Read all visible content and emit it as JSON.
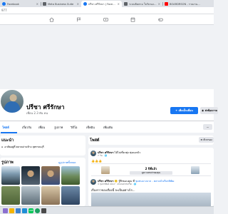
{
  "browser": {
    "tabs": [
      {
        "label": "Facebook",
        "icon": "facebook-icon",
        "active": false
      },
      {
        "label": "Meta Business Suite",
        "icon": "document-icon",
        "active": false
      },
      {
        "label": "ปรีชา ศรีรักษา | Facebook",
        "icon": "facebook-icon",
        "active": true
      },
      {
        "label": "ระบบติดตาม ใบรับรองแพทย์ออนไลน์",
        "icon": "document-icon",
        "active": false
      },
      {
        "label": "BOARDRSON - รายงานผลโพล",
        "icon": "youtube-icon",
        "active": false
      }
    ],
    "address_fragment": "977"
  },
  "profile": {
    "name": "ปรีชา ศรีรักษา",
    "friends": "เพื่อน 2.3 พัน คน",
    "add_friend_label": "เพิ่มเป็นเพื่อน",
    "message_label": "ส่งข้อความ"
  },
  "profile_tabs": [
    {
      "label": "โพสต์",
      "active": true
    },
    {
      "label": "เกี่ยวกับ",
      "active": false
    },
    {
      "label": "เพื่อน",
      "active": false
    },
    {
      "label": "รูปภาพ",
      "active": false
    },
    {
      "label": "วิดีโอ",
      "active": false
    },
    {
      "label": "เช็คอิน",
      "active": false
    },
    {
      "label": "เพิ่มเติม",
      "active": false
    }
  ],
  "more_label": "···",
  "intro": {
    "title": "แนะนำ",
    "line": "อาศัยอยู่ที่ ตลาดด่านช้าง สุพรรณบุรี"
  },
  "photos": {
    "title": "รูปภาพ",
    "see_all": "ดูรูปภาพทั้งหมด"
  },
  "posts": {
    "title": "โพสต์",
    "filter_label": "ตัวกรอง"
  },
  "post1": {
    "author": "ปรีชา ศรีรักษา",
    "action": " ได้ไปเที่ยวทุ่ง ทุ่งดอกบัว",
    "time": "7 วัน · 🌐",
    "reactions": "👍👍👍"
  },
  "event": {
    "title": "2 ปีที่แล้ว",
    "subtitle": "ดูความทรงจำของคุณ"
  },
  "post2": {
    "author": "ปรีชา ศรีรักษา",
    "mid": " 🙂 รู้สึกขอบคุณ ที่ ",
    "link": "ชุมชนบางบาล - ตลาดบัวเกียรติพัฒ",
    "time": "3 กุมภาพันธ์ 2017 · อำเภอปากเกร็ด · 🌐",
    "text": "เรื่องราวของเรื่องนี้ จะเป็นอย่างไร..."
  },
  "taskbar": {
    "line_label": "LINE"
  },
  "colors": {
    "facebook_blue": "#1877f2",
    "page_bg": "#f0f2f5",
    "secondary_text": "#65676b"
  }
}
